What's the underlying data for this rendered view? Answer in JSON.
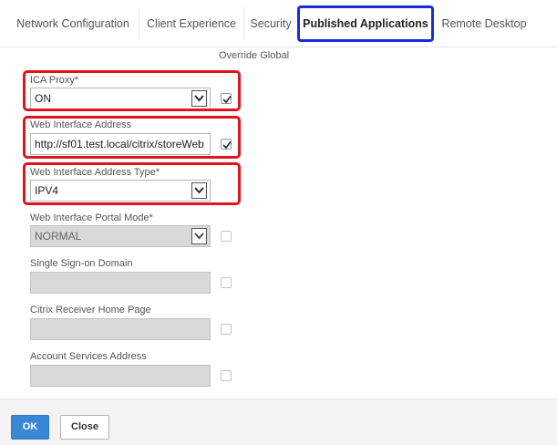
{
  "tabs": [
    {
      "label": "Network Configuration"
    },
    {
      "label": "Client Experience"
    },
    {
      "label": "Security"
    },
    {
      "label": "Published Applications"
    },
    {
      "label": "Remote Desktop"
    }
  ],
  "override_label": "Override Global",
  "fields": {
    "ica_proxy": {
      "label": "ICA Proxy*",
      "value": "ON",
      "override_checked": true
    },
    "web_interface_address": {
      "label": "Web Interface Address",
      "value": "http://sf01.test.local/citrix/storeWeb",
      "override_checked": true
    },
    "web_interface_address_type": {
      "label": "Web Interface Address Type*",
      "value": "IPV4"
    },
    "web_interface_portal_mode": {
      "label": "Web Interface Portal Mode*",
      "value": "NORMAL",
      "override_checked": false
    },
    "single_sign_on_domain": {
      "label": "Single Sign-on Domain",
      "value": "",
      "override_checked": false
    },
    "citrix_receiver_home_page": {
      "label": "Citrix Receiver Home Page",
      "value": "",
      "override_checked": false
    },
    "account_services_address": {
      "label": "Account Services Address",
      "value": "",
      "override_checked": false
    }
  },
  "buttons": {
    "ok": "OK",
    "close": "Close"
  },
  "colors": {
    "highlight_red": "#e0141e",
    "active_tab_border": "#1d2bd6",
    "primary_button": "#3a87d6"
  }
}
